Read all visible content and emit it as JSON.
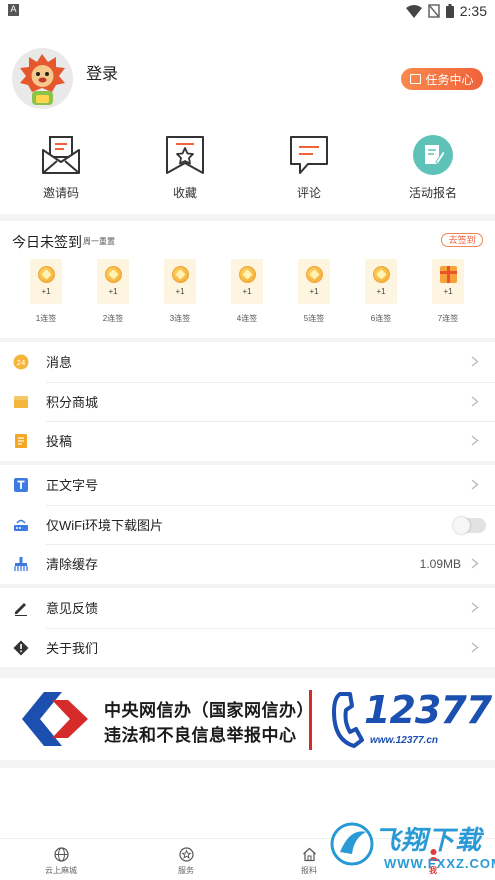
{
  "status_bar": {
    "notification_letter": "A",
    "time": "2:35"
  },
  "profile": {
    "login_label": "登录",
    "task_center_label": "任务中心"
  },
  "quick_actions": [
    {
      "label": "邀请码",
      "icon": "envelope-icon"
    },
    {
      "label": "收藏",
      "icon": "bookmark-star-icon"
    },
    {
      "label": "评论",
      "icon": "comment-icon"
    },
    {
      "label": "活动报名",
      "icon": "signup-icon"
    }
  ],
  "signin": {
    "title": "今日未签到",
    "subtitle": "周一重置",
    "button_label": "去签到",
    "days": [
      {
        "reward": "+1",
        "label": "1连签"
      },
      {
        "reward": "+1",
        "label": "2连签"
      },
      {
        "reward": "+1",
        "label": "3连签"
      },
      {
        "reward": "+1",
        "label": "4连签"
      },
      {
        "reward": "+1",
        "label": "5连签"
      },
      {
        "reward": "+1",
        "label": "6连签"
      },
      {
        "reward": "+1",
        "label": "7连签"
      }
    ]
  },
  "menu_group_1": [
    {
      "label": "消息",
      "icon": "message-icon"
    },
    {
      "label": "积分商城",
      "icon": "points-mall-icon"
    },
    {
      "label": "投稿",
      "icon": "submission-icon"
    }
  ],
  "menu_group_2": {
    "font_size": {
      "label": "正文字号"
    },
    "wifi_only": {
      "label": "仅WiFi环境下载图片",
      "enabled": false
    },
    "clear_cache": {
      "label": "清除缓存",
      "value": "1.09MB"
    }
  },
  "menu_group_3": [
    {
      "label": "意见反馈",
      "icon": "pencil-icon"
    },
    {
      "label": "关于我们",
      "icon": "info-icon"
    }
  ],
  "banner": {
    "line1": "中央网信办（国家网信办）",
    "line2": "违法和不良信息举报中心",
    "number": "12377",
    "url": "www.12377.cn"
  },
  "tabbar": [
    {
      "label": "云上麻城",
      "icon": "globe-icon"
    },
    {
      "label": "服务",
      "icon": "star-circle-icon"
    },
    {
      "label": "报料",
      "icon": "home-icon"
    },
    {
      "label": "我",
      "icon": "user-icon",
      "active": true
    }
  ],
  "watermark": {
    "text": "飞翔下载",
    "url": "WWW.FXXZ.COM"
  },
  "colors": {
    "accent": "#f0623a",
    "brand_blue": "#1b4fb0",
    "active_tab": "#e4393c"
  }
}
